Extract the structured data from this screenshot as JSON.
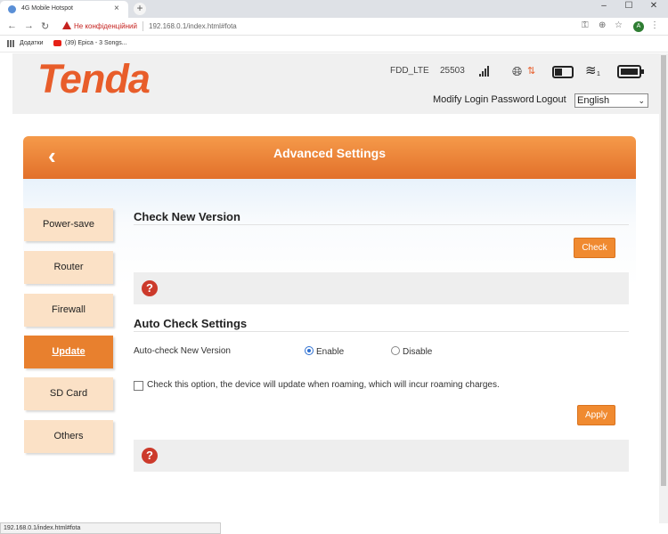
{
  "browser": {
    "tab_title": "4G Mobile Hotspot",
    "tab_close": "×",
    "new_tab": "+",
    "window_min": "–",
    "window_max": "☐",
    "window_close": "✕",
    "not_secure": "Не конфіденційний",
    "url": "192.168.0.1/index.html#fota",
    "profile_initial": "A",
    "bookmarks": [
      "Додатки",
      "(39) Epica - 3 Songs..."
    ],
    "status_url": "192.168.0.1/index.html#fota"
  },
  "header": {
    "logo": "Tenda",
    "network": "FDD_LTE",
    "network_code": "25503",
    "wifi_clients": "1",
    "modify_password": "Modify Login Password",
    "logout": "Logout",
    "language": "English"
  },
  "banner": {
    "back": "‹",
    "title": "Advanced Settings"
  },
  "sidebar": {
    "items": [
      {
        "label": "Power-save"
      },
      {
        "label": "Router"
      },
      {
        "label": "Firewall"
      },
      {
        "label": "Update"
      },
      {
        "label": "SD Card"
      },
      {
        "label": "Others"
      }
    ],
    "active": "Update"
  },
  "check_version": {
    "title": "Check New Version",
    "button": "Check",
    "help": "?"
  },
  "auto_check": {
    "title": "Auto Check Settings",
    "label": "Auto-check New Version",
    "enable": "Enable",
    "disable": "Disable",
    "selected": "Enable",
    "roaming_checked": false,
    "roaming_text": "Check this option, the device will update when roaming, which will incur roaming charges.",
    "apply": "Apply",
    "help": "?"
  },
  "colors": {
    "accent": "#e8802e",
    "logo": "#e85d2a",
    "help": "#cc3a2b"
  }
}
